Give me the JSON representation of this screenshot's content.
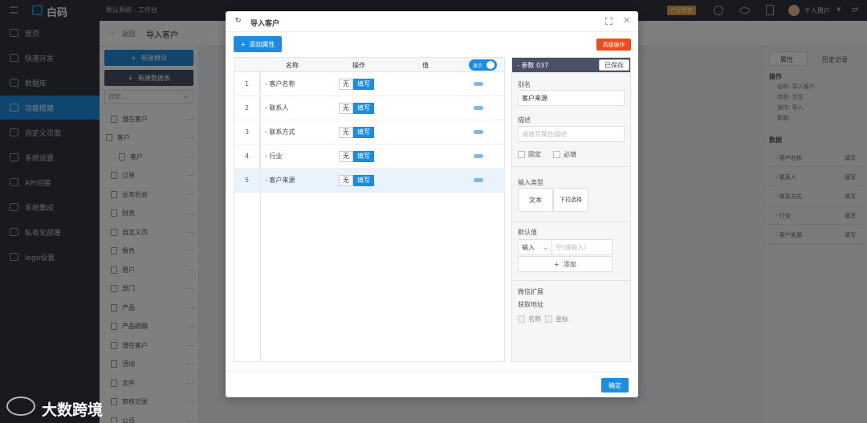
{
  "app": {
    "logo_text": "白码",
    "top_title": "默认系统 - 工作台",
    "top_badge": "产品预览",
    "user_name": "个人用户"
  },
  "sidebar": {
    "items": [
      {
        "label": "首页",
        "active": false
      },
      {
        "label": "快速开发",
        "active": false
      },
      {
        "label": "数据库",
        "active": false
      },
      {
        "label": "功能搭建",
        "active": true
      },
      {
        "label": "自定义页面",
        "active": false
      },
      {
        "label": "系统设置",
        "active": false
      },
      {
        "label": "API对接",
        "active": false
      },
      {
        "label": "系统集成",
        "active": false
      },
      {
        "label": "私有化部署",
        "active": false
      },
      {
        "label": "logo设置",
        "active": false
      }
    ]
  },
  "page": {
    "back_label": "返回",
    "title": "导入客户"
  },
  "left_panel": {
    "new_module": "新建模块",
    "new_table": "新建数据表",
    "search_placeholder": "搜索...",
    "tree": [
      "潜在客户",
      "客户",
      "客户",
      "订单",
      "业务机会",
      "财务",
      "自定义页",
      "角色",
      "用户",
      "部门",
      "产品",
      "产品明细",
      "潜在客户",
      "活动",
      "文件",
      "审核记录",
      "公司"
    ]
  },
  "right_panel": {
    "tabs": [
      "属性",
      "历史记录"
    ],
    "section_op": "操作",
    "props": [
      {
        "k": "名称:",
        "v": "导入客户"
      },
      {
        "k": "类型:",
        "v": "交互"
      },
      {
        "k": "操作:",
        "v": "导入"
      },
      {
        "k": "数据:",
        "v": ""
      }
    ],
    "section_data": "数据",
    "rows": [
      {
        "name": "- 客户名称",
        "v": "填写"
      },
      {
        "name": "- 联系人",
        "v": "填写"
      },
      {
        "name": "- 联系方式",
        "v": "填写"
      },
      {
        "name": "- 行业",
        "v": "填写"
      },
      {
        "name": "- 客户来源",
        "v": "填写"
      }
    ]
  },
  "modal": {
    "title": "导入客户",
    "add_attr": "添加属性",
    "danger_btn": "高级操作",
    "headers": {
      "name": "名称",
      "op": "操作",
      "value": "值"
    },
    "toggle_label": "显示",
    "rows": [
      {
        "no": "1",
        "name": "- 客户名称",
        "opt_a": "无",
        "opt_b": "填写"
      },
      {
        "no": "2",
        "name": "- 联系人",
        "opt_a": "无",
        "opt_b": "填写"
      },
      {
        "no": "3",
        "name": "- 联系方式",
        "opt_a": "无",
        "opt_b": "填写"
      },
      {
        "no": "4",
        "name": "- 行业",
        "opt_a": "无",
        "opt_b": "填写"
      },
      {
        "no": "5",
        "name": "- 客户来源",
        "opt_a": "无",
        "opt_b": "填写"
      }
    ],
    "selected_row": 4,
    "param": {
      "header": "- 参数 037",
      "saved": "已保存",
      "alias_label": "别名",
      "alias_value": "客户来源",
      "desc_label": "描述",
      "desc_placeholder": "请填写属性描述",
      "fixed_label": "固定",
      "required_label": "必填",
      "input_type_label": "输入类型",
      "type_text": "文本",
      "type_select": "下拉选择",
      "default_label": "默认值",
      "default_select": "输入",
      "default_placeholder": "空(请输入)",
      "add_label": "添加",
      "wechat_label": "微信扩展",
      "get_addr_label": "获取地址",
      "name_label": "名称",
      "coord_label": "坐标"
    },
    "confirm": "确定"
  },
  "watermark": "大数跨境",
  "colors": {
    "primary": "#1d8ce0",
    "danger": "#f04b1d",
    "dark": "#30343e",
    "header": "#4a5065"
  }
}
